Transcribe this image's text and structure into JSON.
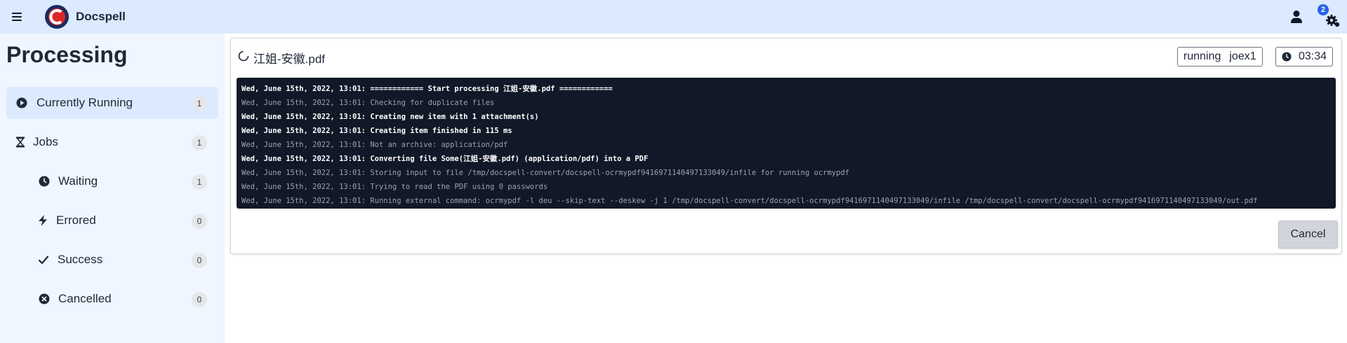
{
  "header": {
    "app_name": "Docspell",
    "notification_count": "2",
    "icons": {
      "menu": "hamburger-icon",
      "logo": "docspell-logo",
      "user": "user-icon",
      "settings": "cogs-icon"
    }
  },
  "sidebar": {
    "title": "Processing",
    "items": [
      {
        "label": "Currently Running",
        "count": "1",
        "icon": "play-circle-icon",
        "active": true
      },
      {
        "label": "Jobs",
        "count": "1",
        "icon": "hourglass-icon"
      },
      {
        "label": "Waiting",
        "count": "1",
        "icon": "clock-icon"
      },
      {
        "label": "Errored",
        "count": "0",
        "icon": "bolt-icon"
      },
      {
        "label": "Success",
        "count": "0",
        "icon": "check-icon"
      },
      {
        "label": "Cancelled",
        "count": "0",
        "icon": "times-circle-icon"
      }
    ]
  },
  "job": {
    "file_name": "江姐-安徽.pdf",
    "state": "running",
    "worker": "joex1",
    "duration": "03:34",
    "cancel_label": "Cancel",
    "log": [
      {
        "level": "info",
        "text": "Wed, June 15th, 2022, 13:01: ============ Start processing 江姐-安徽.pdf ============"
      },
      {
        "level": "debug",
        "text": "Wed, June 15th, 2022, 13:01: Checking for duplicate files"
      },
      {
        "level": "info",
        "text": "Wed, June 15th, 2022, 13:01: Creating new item with 1 attachment(s)"
      },
      {
        "level": "info",
        "text": "Wed, June 15th, 2022, 13:01: Creating item finished in 115 ms"
      },
      {
        "level": "debug",
        "text": "Wed, June 15th, 2022, 13:01: Not an archive: application/pdf"
      },
      {
        "level": "info",
        "text": "Wed, June 15th, 2022, 13:01: Converting file Some(江姐-安徽.pdf) (application/pdf) into a PDF"
      },
      {
        "level": "debug",
        "text": "Wed, June 15th, 2022, 13:01: Storing input to file /tmp/docspell-convert/docspell-ocrmypdf9416971140497133049/infile for running ocrmypdf"
      },
      {
        "level": "debug",
        "text": "Wed, June 15th, 2022, 13:01: Trying to read the PDF using 0 passwords"
      },
      {
        "level": "debug",
        "text": "Wed, June 15th, 2022, 13:01: Running external command: ocrmypdf -l deu --skip-text --deskew -j 1 /tmp/docspell-convert/docspell-ocrmypdf9416971140497133049/infile /tmp/docspell-convert/docspell-ocrmypdf9416971140497133049/out.pdf"
      }
    ]
  }
}
